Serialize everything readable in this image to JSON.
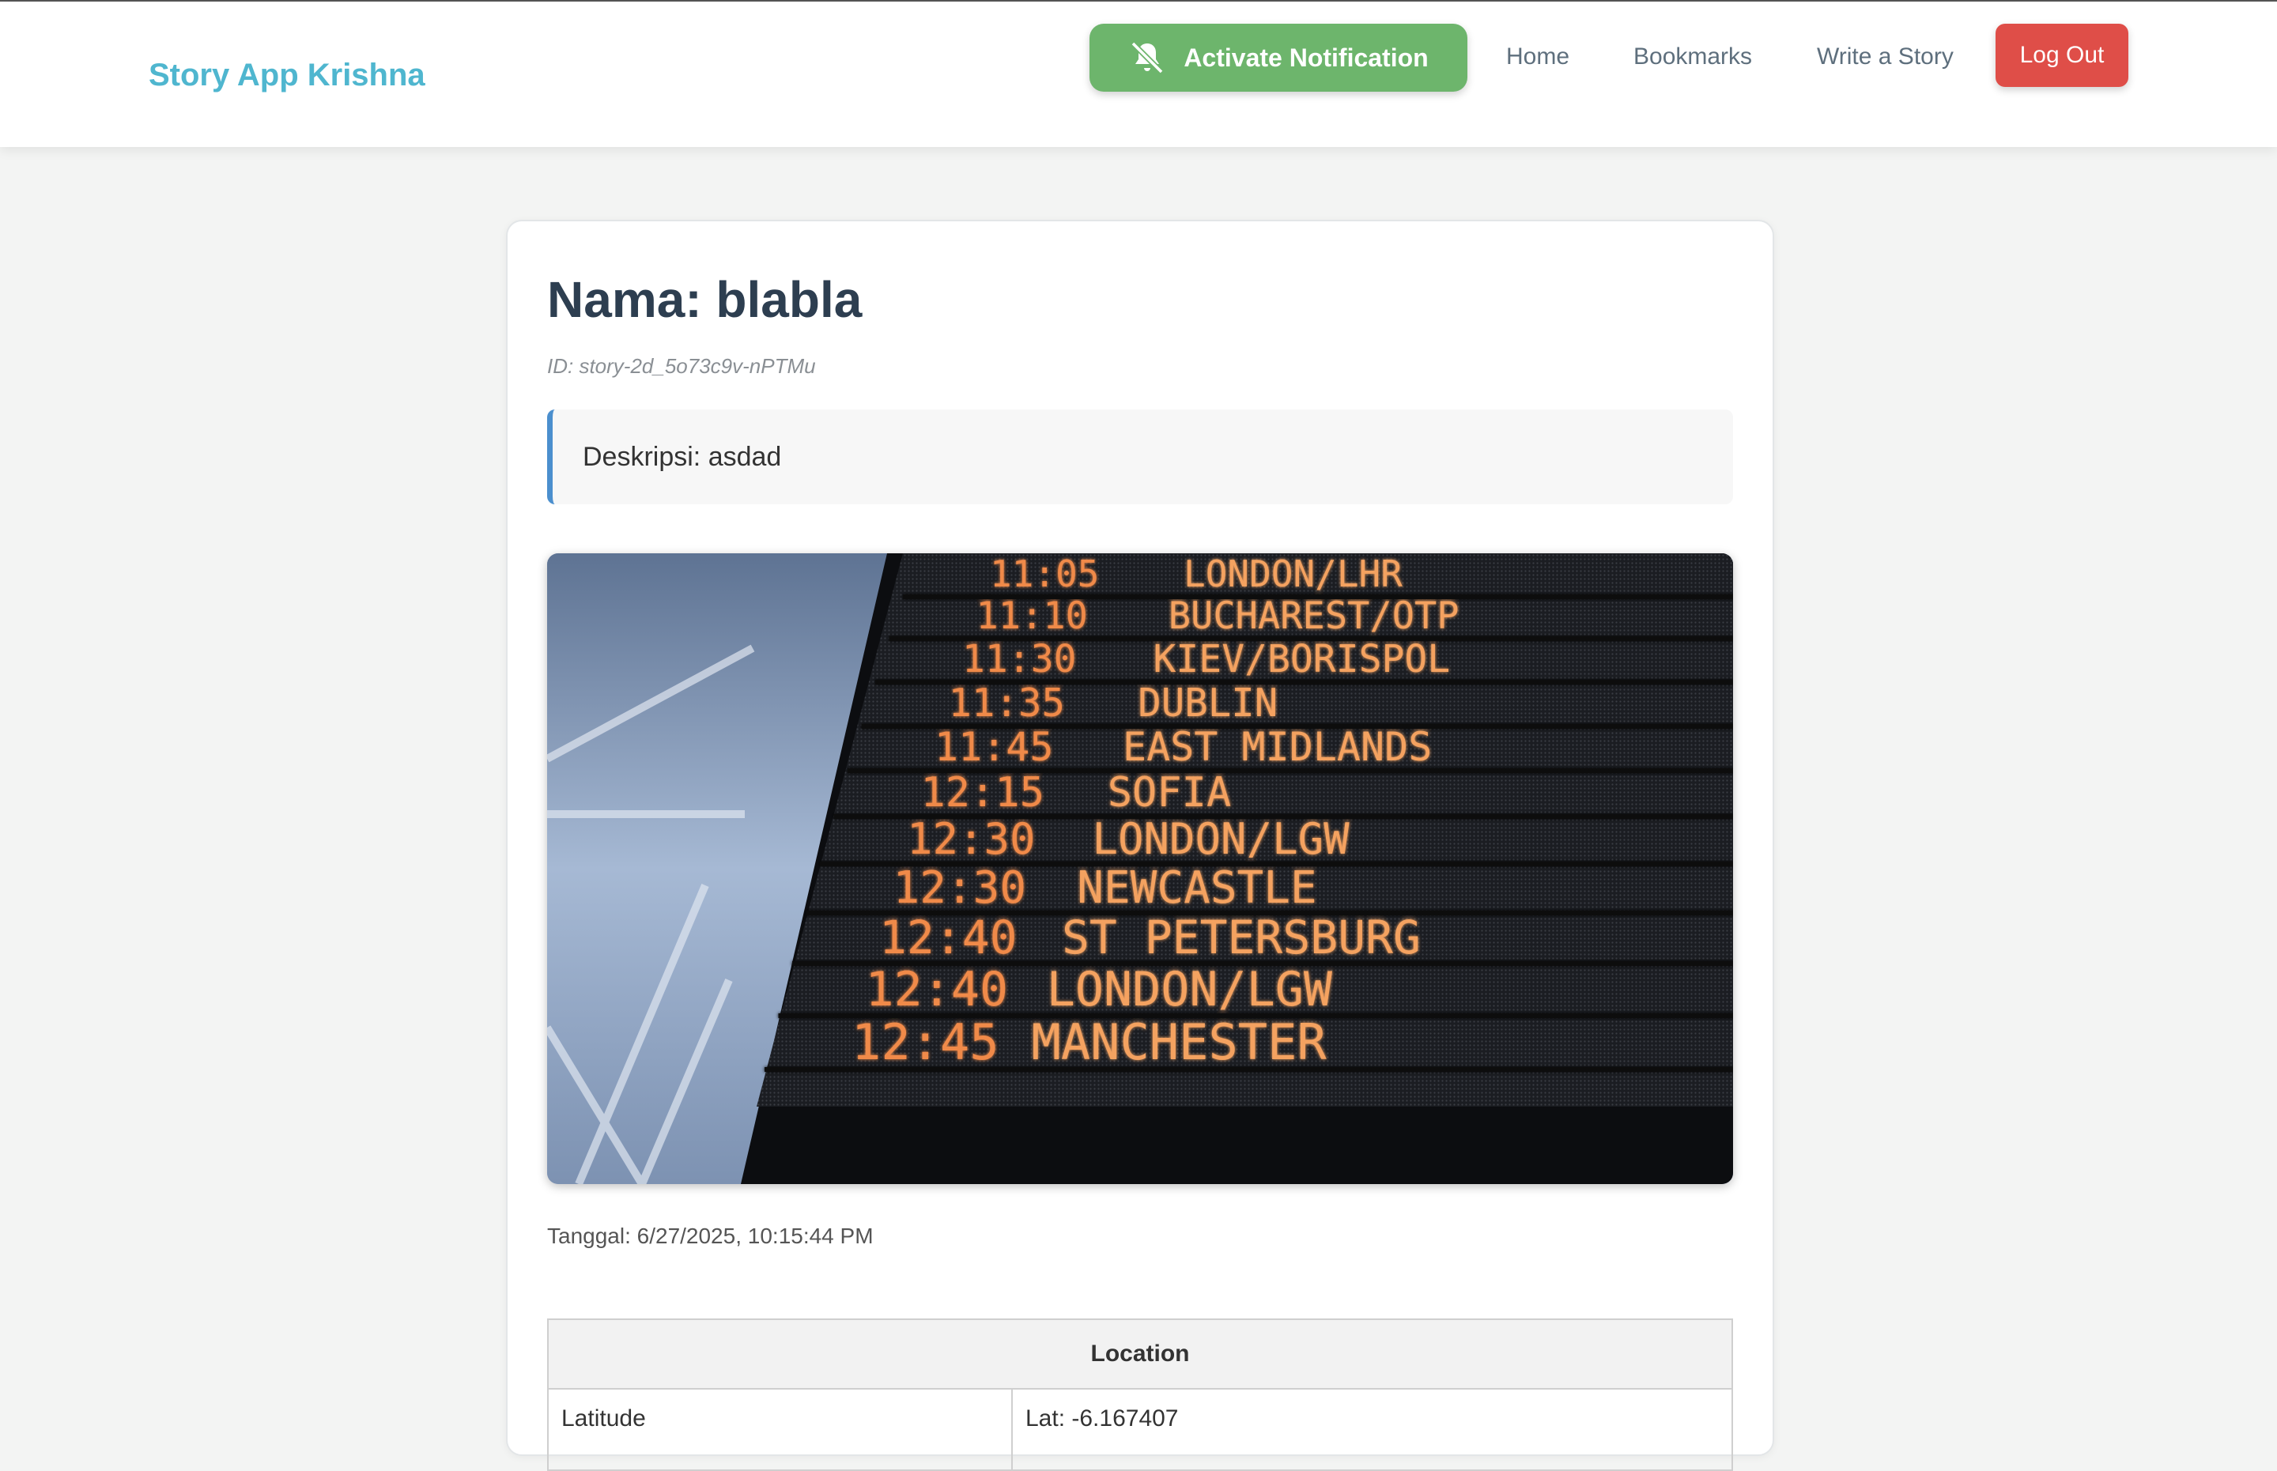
{
  "header": {
    "brand": "Story App Krishna",
    "notify_label": "Activate Notification",
    "nav": {
      "home": "Home",
      "bookmarks": "Bookmarks",
      "write": "Write a Story"
    },
    "logout_label": "Log Out",
    "colors": {
      "brand": "#4fb6cf",
      "notify": "#6db56c",
      "logout": "#df4e48"
    }
  },
  "story": {
    "name_line": "Nama: blabla",
    "id_line": "ID: story-2d_5o73c9v-nPTMu",
    "description_line": "Deskripsi: asdad",
    "date_line": "Tanggal: 6/27/2025, 10:15:44 PM",
    "board": [
      {
        "time": "11:05",
        "dest": "LONDON/LHR"
      },
      {
        "time": "11:10",
        "dest": "BUCHAREST/OTP"
      },
      {
        "time": "11:30",
        "dest": "KIEV/BORISPOL"
      },
      {
        "time": "11:35",
        "dest": "DUBLIN"
      },
      {
        "time": "11:45",
        "dest": "EAST MIDLANDS"
      },
      {
        "time": "12:15",
        "dest": "SOFIA"
      },
      {
        "time": "12:30",
        "dest": "LONDON/LGW"
      },
      {
        "time": "12:30",
        "dest": "NEWCASTLE"
      },
      {
        "time": "12:40",
        "dest": "ST PETERSBURG"
      },
      {
        "time": "12:40",
        "dest": "LONDON/LGW"
      },
      {
        "time": "12:45",
        "dest": "MANCHESTER"
      }
    ]
  },
  "location": {
    "header": "Location",
    "rows": [
      {
        "label": "Latitude",
        "value": "Lat: -6.167407"
      }
    ]
  },
  "icons": {
    "notify": "bell-off-icon"
  }
}
